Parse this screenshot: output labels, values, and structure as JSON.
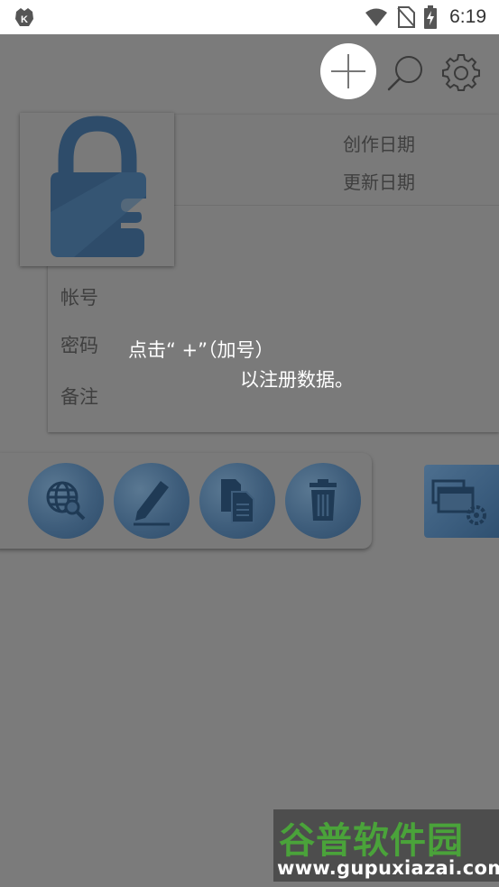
{
  "status_bar": {
    "time": "6:19",
    "icons": [
      "app-notification-icon",
      "wifi-icon",
      "no-sim-icon",
      "battery-charging-icon"
    ]
  },
  "toolbar": {
    "icons": [
      "plus-icon",
      "search-icon",
      "gear-icon"
    ]
  },
  "entry_card": {
    "created_date_label": "创作日期",
    "updated_date_label": "更新日期",
    "account_label": "帐号",
    "password_label": "密码",
    "note_label": "备注",
    "logo_icon": "padlock-icon"
  },
  "hint": {
    "line1": "点击“ +”（加号）",
    "line2": "以注册数据。"
  },
  "actions": {
    "icons": [
      "globe-search-icon",
      "pencil-icon",
      "copy-icon",
      "trash-icon",
      "manage-windows-gear-icon"
    ]
  },
  "watermark": {
    "title": "谷普软件园",
    "url": "www.gupuxiazai.com"
  },
  "colors": {
    "overlay": "#7b7b7b",
    "action_blue": "#3e5d7b",
    "watermark_green": "#4aa33a"
  }
}
